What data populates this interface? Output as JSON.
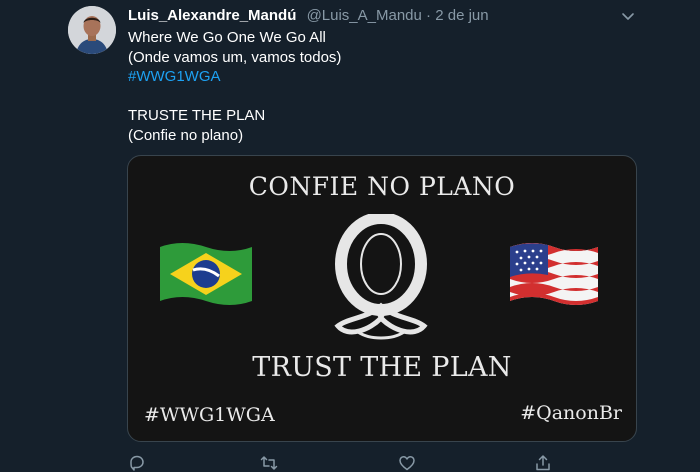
{
  "tweet": {
    "author_name": "Luis_Alexandre_Mandú",
    "author_handle": "@Luis_A_Mandu",
    "separator": "·",
    "date": "2 de jun",
    "lines": [
      "Where We Go One We Go All",
      "(Onde vamos um, vamos todos)",
      "#WWG1WGA",
      "",
      "TRUSTE THE PLAN",
      "(Confie no plano)"
    ]
  },
  "media": {
    "title": "CONFIE NO PLANO",
    "subtitle": "TRUST THE PLAN",
    "hashtag_left": "#WWG1WGA",
    "hashtag_right": "#QanonBr",
    "logo_icon": "q-logo-icon",
    "left_flag": "flag-brazil-icon",
    "right_flag": "flag-usa-icon"
  },
  "actions": [
    "reply-icon",
    "retweet-icon",
    "like-icon",
    "share-icon"
  ],
  "colors": {
    "background": "#15202b",
    "secondary_text": "#8899a6",
    "link": "#1da1f2",
    "border": "#38444d",
    "card_bg": "#141414"
  }
}
